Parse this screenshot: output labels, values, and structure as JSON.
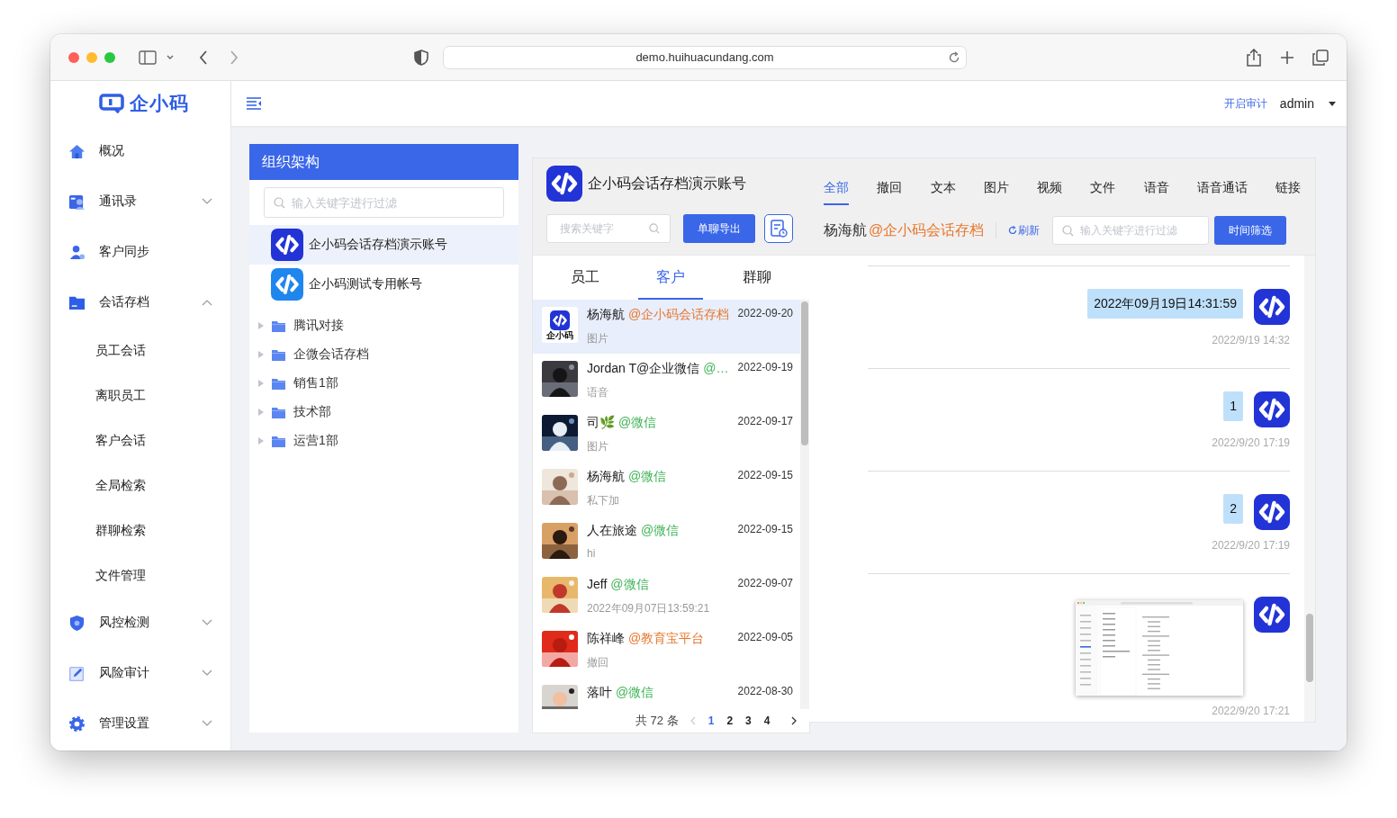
{
  "browser": {
    "url": "demo.huihuacundang.com"
  },
  "sidebar": {
    "logo_text": "企小码",
    "items": [
      {
        "label": "概况",
        "kind": "link"
      },
      {
        "label": "通讯录",
        "kind": "group",
        "expanded": false
      },
      {
        "label": "客户同步",
        "kind": "link"
      },
      {
        "label": "会话存档",
        "kind": "group",
        "expanded": true,
        "children": [
          {
            "label": "员工会话"
          },
          {
            "label": "离职员工"
          },
          {
            "label": "客户会话"
          },
          {
            "label": "全局检索"
          },
          {
            "label": "群聊检索"
          },
          {
            "label": "文件管理"
          }
        ]
      },
      {
        "label": "风控检测",
        "kind": "group",
        "expanded": false
      },
      {
        "label": "风险审计",
        "kind": "group",
        "expanded": false
      },
      {
        "label": "管理设置",
        "kind": "group",
        "expanded": false
      }
    ]
  },
  "header": {
    "audit_link": "开启审计",
    "user": "admin"
  },
  "org": {
    "title": "组织架构",
    "search": {
      "placeholder": "输入关键字进行过滤"
    },
    "accounts": [
      {
        "name": "企小码会话存档演示账号",
        "selected": true
      },
      {
        "name": "企小码测试专用帐号",
        "selected": false
      }
    ],
    "departments": [
      {
        "name": "腾讯对接",
        "expanded": false
      },
      {
        "name": "企微会话存档",
        "expanded": false
      },
      {
        "name": "销售1部",
        "expanded": false
      },
      {
        "name": "技术部",
        "expanded": false
      },
      {
        "name": "运营1部",
        "expanded": false
      }
    ]
  },
  "chat_list": {
    "account": "企小码会话存档演示账号",
    "search": {
      "placeholder": "搜索关键字"
    },
    "export_button": "单聊导出",
    "tabs": [
      {
        "label": "员工",
        "selected": false
      },
      {
        "label": "客户",
        "selected": true
      },
      {
        "label": "群聊",
        "selected": false
      }
    ],
    "chats": [
      {
        "name": "杨海航",
        "tag": "@企小码会话存档",
        "color": "#e8762d",
        "preview": "图片",
        "date": "2022-09-20",
        "selected": true,
        "avatar": {
          "kind": "logo",
          "text": "企小码"
        }
      },
      {
        "name": "Jordan T@企业微信",
        "tag": "@…",
        "color": "#3fb356",
        "preview": "语音",
        "date": "2022-09-19",
        "selected": false
      },
      {
        "name": "司🌿",
        "tag": "@微信",
        "color": "#3fb356",
        "preview": "图片",
        "date": "2022-09-17",
        "selected": false
      },
      {
        "name": "杨海航",
        "tag": "@微信",
        "color": "#3fb356",
        "preview": "私下加",
        "date": "2022-09-15",
        "selected": false
      },
      {
        "name": "人在旅途",
        "tag": "@微信",
        "color": "#3fb356",
        "preview": "hi",
        "date": "2022-09-15",
        "selected": false
      },
      {
        "name": "Jeff",
        "tag": "@微信",
        "color": "#3fb356",
        "preview": "2022年09月07日13:59:21",
        "date": "2022-09-07",
        "selected": false
      },
      {
        "name": "陈祥峰",
        "tag": "@教育宝平台",
        "color": "#e8762d",
        "preview": "撤回",
        "date": "2022-09-05",
        "selected": false
      },
      {
        "name": "落叶",
        "tag": "@微信",
        "color": "#3fb356",
        "date": "2022-08-30",
        "selected": false
      }
    ],
    "pagination": {
      "total": "共 72 条",
      "pages": [
        {
          "label": "1",
          "selected": true
        },
        {
          "label": "2",
          "selected": false
        },
        {
          "label": "3",
          "selected": false
        },
        {
          "label": "4",
          "selected": false
        }
      ]
    }
  },
  "conversation": {
    "tabs": [
      {
        "label": "全部",
        "selected": true
      },
      {
        "label": "撤回",
        "selected": false
      },
      {
        "label": "文本",
        "selected": false
      },
      {
        "label": "图片",
        "selected": false
      },
      {
        "label": "视频",
        "selected": false
      },
      {
        "label": "文件",
        "selected": false
      },
      {
        "label": "语音",
        "selected": false
      },
      {
        "label": "语音通话",
        "selected": false
      },
      {
        "label": "链接",
        "selected": false
      }
    ],
    "contact": "杨海航",
    "contact_tag": "@企小码会话存档",
    "refresh": "刷新",
    "search": {
      "placeholder": "输入关键字进行过滤"
    },
    "time_filter_button": "时间筛选",
    "messages": [
      {
        "kind": "text",
        "text": "2022年09月19日14:31:59",
        "time": "2022/9/19 14:32"
      },
      {
        "kind": "text",
        "text": "1",
        "time": "2022/9/20 17:19"
      },
      {
        "kind": "text",
        "text": "2",
        "time": "2022/9/20 17:19"
      },
      {
        "time": "2022/9/20 17:21"
      }
    ]
  }
}
